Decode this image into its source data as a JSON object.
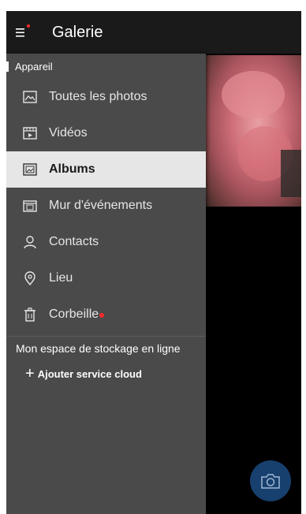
{
  "app": {
    "title": "Galerie"
  },
  "colors": {
    "accent_dot": "#ff2a2a",
    "drawer_bg": "#4a4a4a",
    "active_bg": "#e6e6e6",
    "fab_bg": "#17406e"
  },
  "drawer": {
    "section_device": "Appareil",
    "items": [
      {
        "label": "Toutes les photos",
        "icon": "image-icon",
        "active": false
      },
      {
        "label": "Vidéos",
        "icon": "video-icon",
        "active": false
      },
      {
        "label": "Albums",
        "icon": "album-icon",
        "active": true
      },
      {
        "label": "Mur d'événements",
        "icon": "event-wall-icon",
        "active": false
      },
      {
        "label": "Contacts",
        "icon": "person-icon",
        "active": false
      },
      {
        "label": "Lieu",
        "icon": "location-pin-icon",
        "active": false
      },
      {
        "label": "Corbeille",
        "icon": "trash-icon",
        "active": false,
        "badge": true
      }
    ],
    "section_cloud": "Mon espace de stockage en ligne",
    "add_cloud": {
      "plus": "+",
      "label": "Ajouter service cloud"
    }
  },
  "fab": {
    "icon": "camera-icon"
  }
}
